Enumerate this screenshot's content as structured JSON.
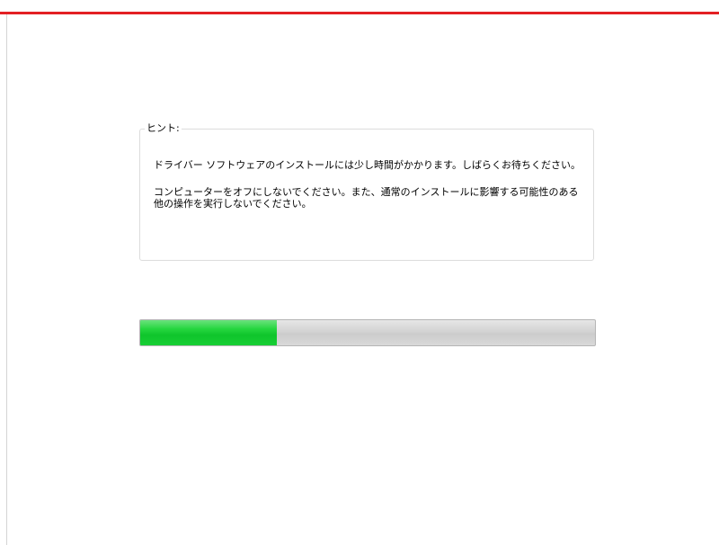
{
  "colors": {
    "accent_bar": "#e32024",
    "progress_fill": "#1bcf36"
  },
  "hint": {
    "title": "ヒント:",
    "line1": "ドライバー ソフトウェアのインストールには少し時間がかかります。しばらくお待ちください。",
    "line2": "コンピューターをオフにしないでください。また、通常のインストールに影響する可能性のある他の操作を実行しないでください。"
  },
  "progress": {
    "fraction": 0.3
  }
}
